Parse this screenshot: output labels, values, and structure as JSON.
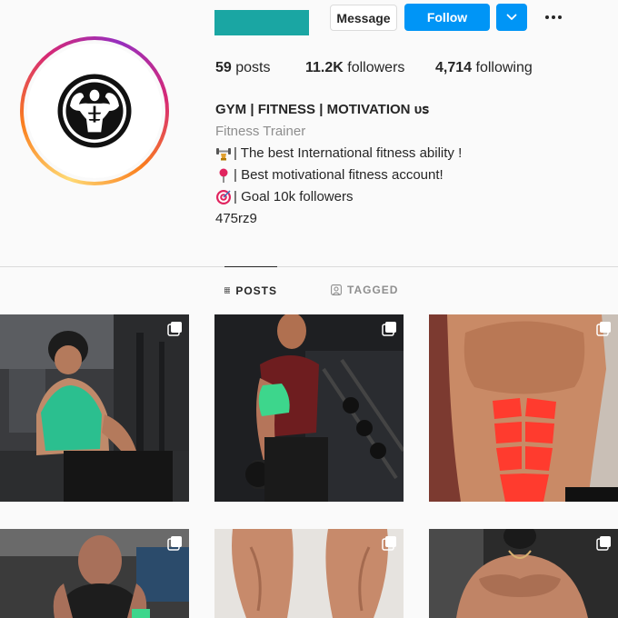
{
  "profile": {
    "username": "",
    "avatar_icon": "bodybuilder-logo-icon",
    "ring_colors": [
      "#feda75",
      "#fa7e1e",
      "#d62976",
      "#962fbf"
    ]
  },
  "actions": {
    "message_label": "Message",
    "follow_label": "Follow",
    "follow_color": "#0095f6",
    "dropdown_icon": "chevron-down-icon",
    "more_icon": "more-options-icon"
  },
  "stats": {
    "posts_count": "59",
    "posts_label": "posts",
    "followers_count": "11.2K",
    "followers_label": "followers",
    "following_count": "4,714",
    "following_label": "following"
  },
  "bio": {
    "name": "GYM | FITNESS | MOTIVATION ᴜꜱ",
    "category": "Fitness Trainer",
    "lines": [
      {
        "emoji": "dumbbell-trophy-emoji",
        "text": "| The best International fitness ability !"
      },
      {
        "emoji": "pushpin-emoji",
        "text": "| Best motivational fitness account!"
      },
      {
        "emoji": "bullseye-emoji",
        "text": "| Goal 10k followers"
      }
    ],
    "extra": "475rz9"
  },
  "tabs": [
    {
      "label": "POSTS",
      "icon": "grid-icon",
      "active": true
    },
    {
      "label": "TAGGED",
      "icon": "tagged-icon",
      "active": false
    }
  ],
  "posts": [
    {
      "subject": "back-muscles-highlight",
      "highlight": "#2bbf8f",
      "multi": true
    },
    {
      "subject": "bicep-curl-highlight",
      "highlight": "#3dd68c",
      "multi": true
    },
    {
      "subject": "abs-highlight",
      "highlight": "#ff3b2e",
      "multi": true
    },
    {
      "subject": "gym-portrait",
      "multi": true
    },
    {
      "subject": "calves-closeup",
      "multi": true
    },
    {
      "subject": "chest-closeup",
      "multi": true
    }
  ]
}
